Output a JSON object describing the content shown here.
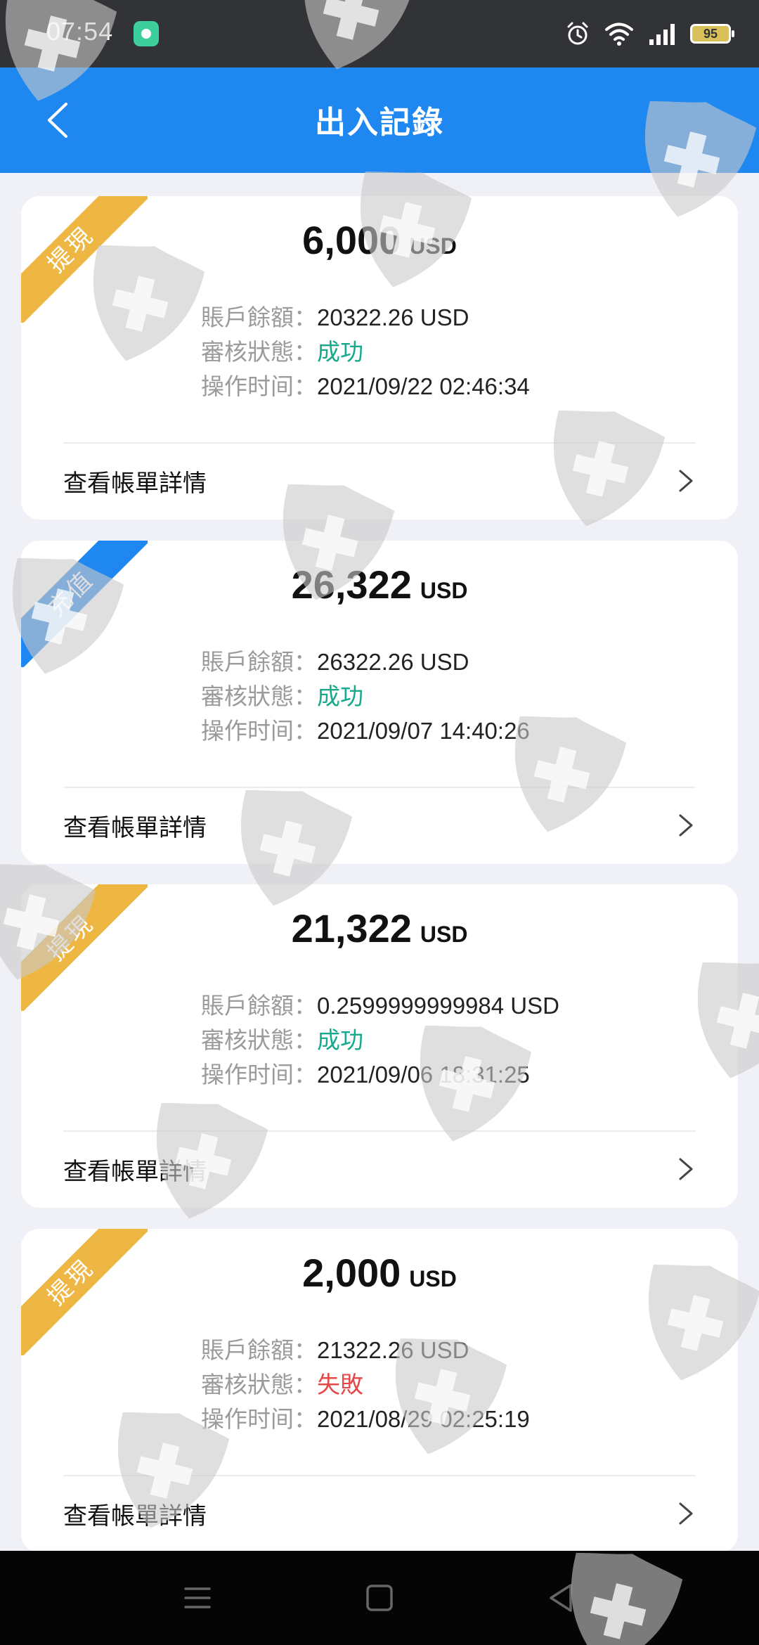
{
  "status_bar": {
    "time": "07:54",
    "battery": "95",
    "icons": [
      "app-notification-icon",
      "alarm-icon",
      "wifi-icon",
      "signal-icon",
      "battery-icon"
    ]
  },
  "header": {
    "title": "出入記錄",
    "back_icon": "chevron-left-icon"
  },
  "colors": {
    "header_bg": "#1e87f0",
    "withdraw_ribbon": "#eeb642",
    "deposit_ribbon": "#1e87f0",
    "success": "#16a98c",
    "failed": "#e54848",
    "page_bg": "#f0f1f7"
  },
  "labels": {
    "balance": "賬戶餘額：",
    "status": "審核狀態：",
    "time": "操作时间：",
    "detail_link": "查看帳單詳情",
    "currency": "USD"
  },
  "records": [
    {
      "tag": "提現",
      "type": "withdraw",
      "amount": "6,000",
      "balance": "20322.26 USD",
      "status": "成功",
      "status_type": "success",
      "time": "2021/09/22 02:46:34"
    },
    {
      "tag": "充值",
      "type": "deposit",
      "amount": "26,322",
      "balance": "26322.26 USD",
      "status": "成功",
      "status_type": "success",
      "time": "2021/09/07 14:40:26"
    },
    {
      "tag": "提現",
      "type": "withdraw",
      "amount": "21,322",
      "balance": "0.2599999999984 USD",
      "status": "成功",
      "status_type": "success",
      "time": "2021/09/06 18:31:25"
    },
    {
      "tag": "提現",
      "type": "withdraw",
      "amount": "2,000",
      "balance": "21322.26 USD",
      "status": "失敗",
      "status_type": "failed",
      "time": "2021/08/29 02:25:19"
    }
  ],
  "nav_bar": {
    "buttons": [
      "menu-icon",
      "home-square-icon",
      "back-triangle-icon"
    ]
  }
}
